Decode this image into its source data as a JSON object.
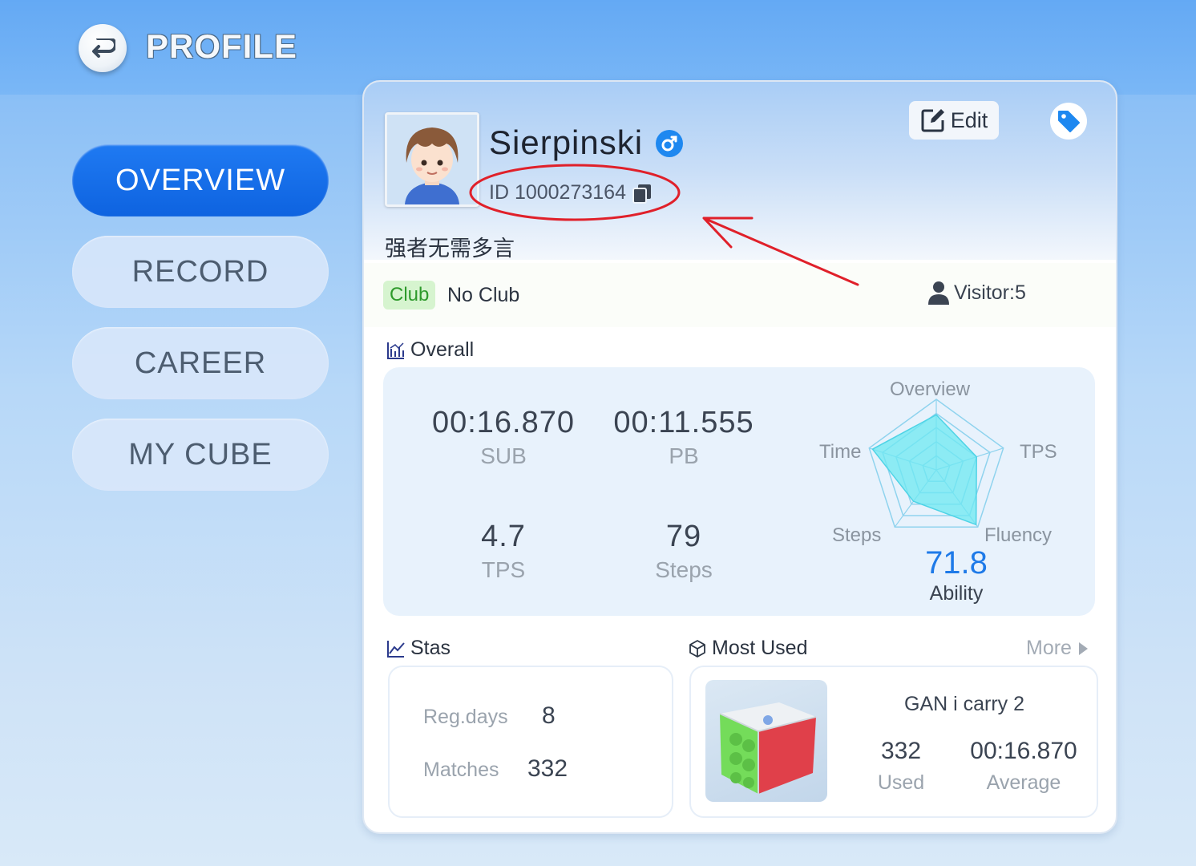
{
  "header": {
    "title": "PROFILE",
    "back_icon": "back-arrow-icon"
  },
  "nav": [
    {
      "label": "OVERVIEW",
      "active": true
    },
    {
      "label": "RECORD",
      "active": false
    },
    {
      "label": "CAREER",
      "active": false
    },
    {
      "label": "MY CUBE",
      "active": false
    }
  ],
  "profile": {
    "username": "Sierpinski",
    "gender_icon": "male-icon",
    "id_text": "ID 1000273164",
    "motto": "强者无需多言",
    "edit_label": "Edit",
    "club_tag": "Club",
    "club_name": "No Club",
    "visitor_text": "Visitor:5"
  },
  "overall": {
    "label": "Overall",
    "sub_value": "00:16.870",
    "sub_label": "SUB",
    "pb_value": "00:11.555",
    "pb_label": "PB",
    "tps_value": "4.7",
    "tps_label": "TPS",
    "steps_value": "79",
    "steps_label": "Steps",
    "radar": {
      "axes": [
        "Overview",
        "TPS",
        "Fluency",
        "Steps",
        "Time"
      ],
      "values": [
        0.78,
        0.6,
        0.96,
        0.55,
        0.95
      ],
      "fill_color": "#6ee8f2",
      "grid_color": "#8fd3ee"
    },
    "ability_value": "71.8",
    "ability_label": "Ability"
  },
  "stas": {
    "label": "Stas",
    "reg_days_label": "Reg.days",
    "reg_days_value": "8",
    "matches_label": "Matches",
    "matches_value": "332"
  },
  "most_used": {
    "label": "Most Used",
    "more_label": "More",
    "cube_name": "GAN i carry 2",
    "used_value": "332",
    "used_label": "Used",
    "average_value": "00:16.870",
    "average_label": "Average"
  },
  "colors": {
    "accent": "#1473ea",
    "ability": "#1e7ae8",
    "annotation": "#e0202a"
  }
}
